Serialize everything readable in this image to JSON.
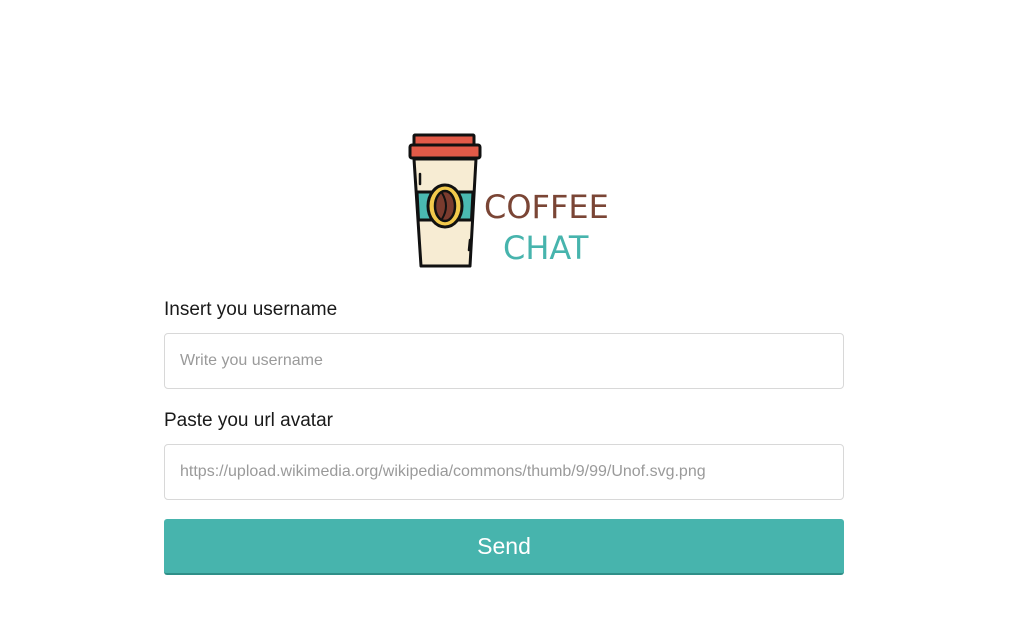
{
  "logo": {
    "icon": "coffee-cup-icon",
    "line1": "COFFEE",
    "line2": "CHAT",
    "line1_color": "#7a4535",
    "line2_color": "#47b4ad"
  },
  "form": {
    "username": {
      "label": "Insert you username",
      "placeholder": "Write you username",
      "value": ""
    },
    "avatar": {
      "label": "Paste you url avatar",
      "placeholder": "https://upload.wikimedia.org/wikipedia/commons/thumb/9/99/Unof.svg.png",
      "value": ""
    },
    "send_label": "Send"
  },
  "colors": {
    "accent": "#47b4ad"
  }
}
